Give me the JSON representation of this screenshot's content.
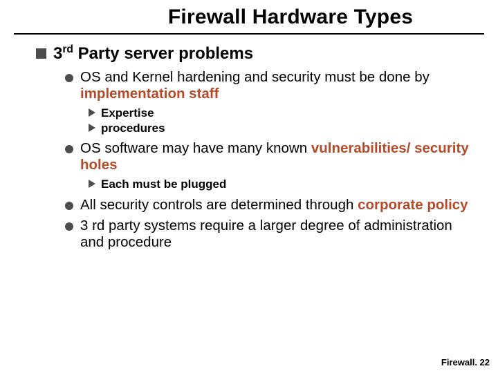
{
  "title": "Firewall Hardware Types",
  "heading": {
    "pre": "3",
    "sup": "rd",
    "post": " Party server problems"
  },
  "b1": {
    "pre": "OS and Kernel hardening and security must be done by ",
    "em": "implementation staff",
    "sub": {
      "a": "Expertise",
      "b": "procedures"
    }
  },
  "b2": {
    "pre": "OS software may have many known ",
    "em": "vulnerabilities/ security holes",
    "sub": {
      "a": "Each must be plugged"
    }
  },
  "b3": {
    "pre": "All security controls are determined through ",
    "em": "corporate policy"
  },
  "b4": {
    "text": "3 rd party systems require a larger degree of administration and procedure"
  },
  "footer": "Firewall. 22"
}
